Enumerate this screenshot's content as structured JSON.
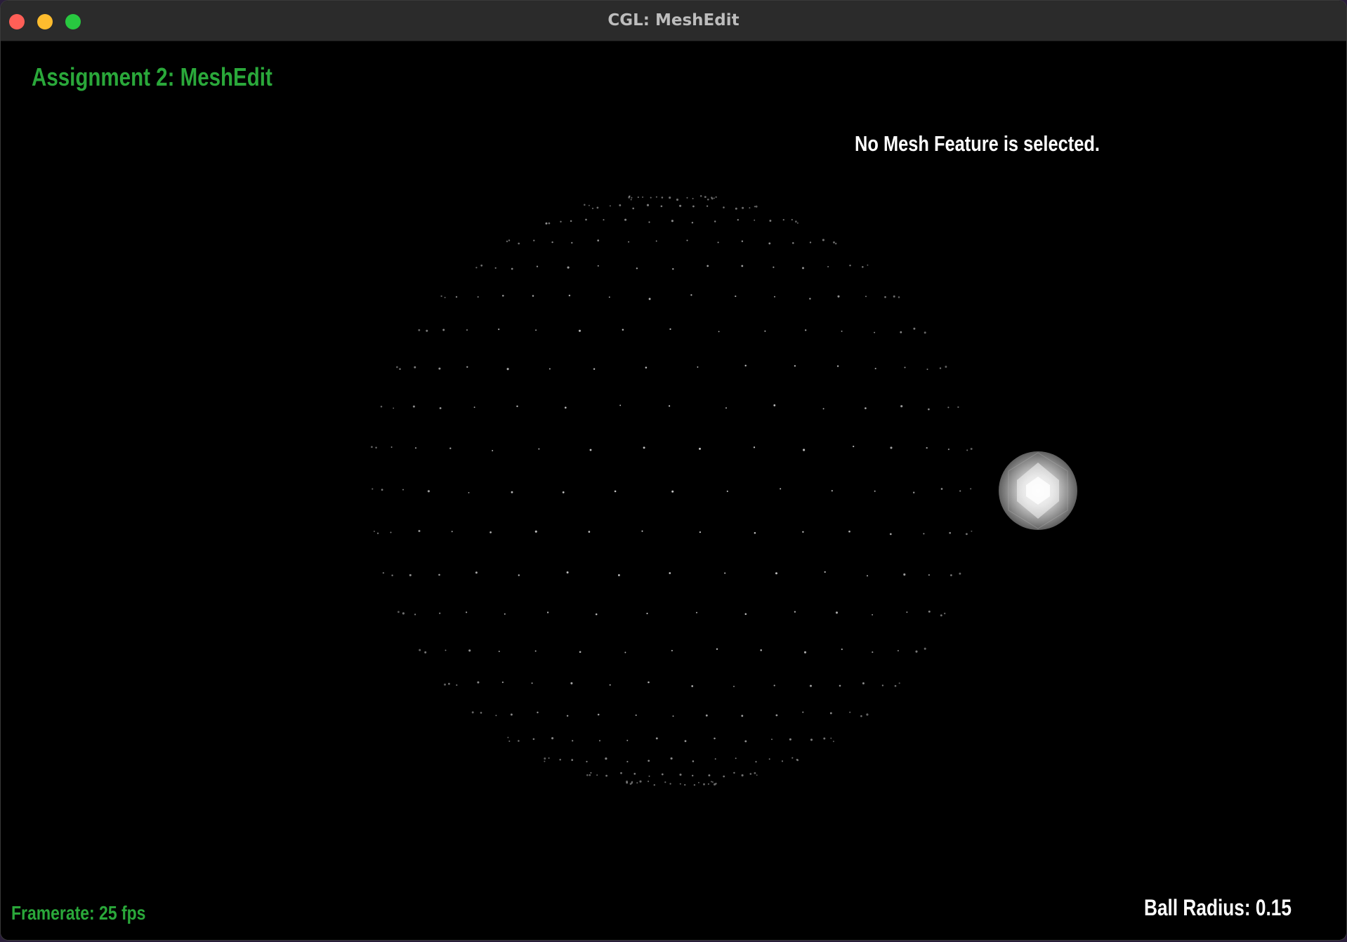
{
  "window": {
    "title": "CGL: MeshEdit"
  },
  "hud": {
    "assignment_title": "Assignment 2: MeshEdit",
    "selection_status": "No Mesh Feature is selected.",
    "framerate": "Framerate: 25 fps",
    "ball_radius": "Ball Radius: 0.15"
  },
  "colors": {
    "background": "#000000",
    "accent_green": "#2aa83a",
    "text_white": "#ffffff",
    "point_color": "#cfcfcf"
  },
  "icons": {
    "close": "close-icon",
    "minimize": "minimize-icon",
    "maximize": "maximize-icon"
  }
}
